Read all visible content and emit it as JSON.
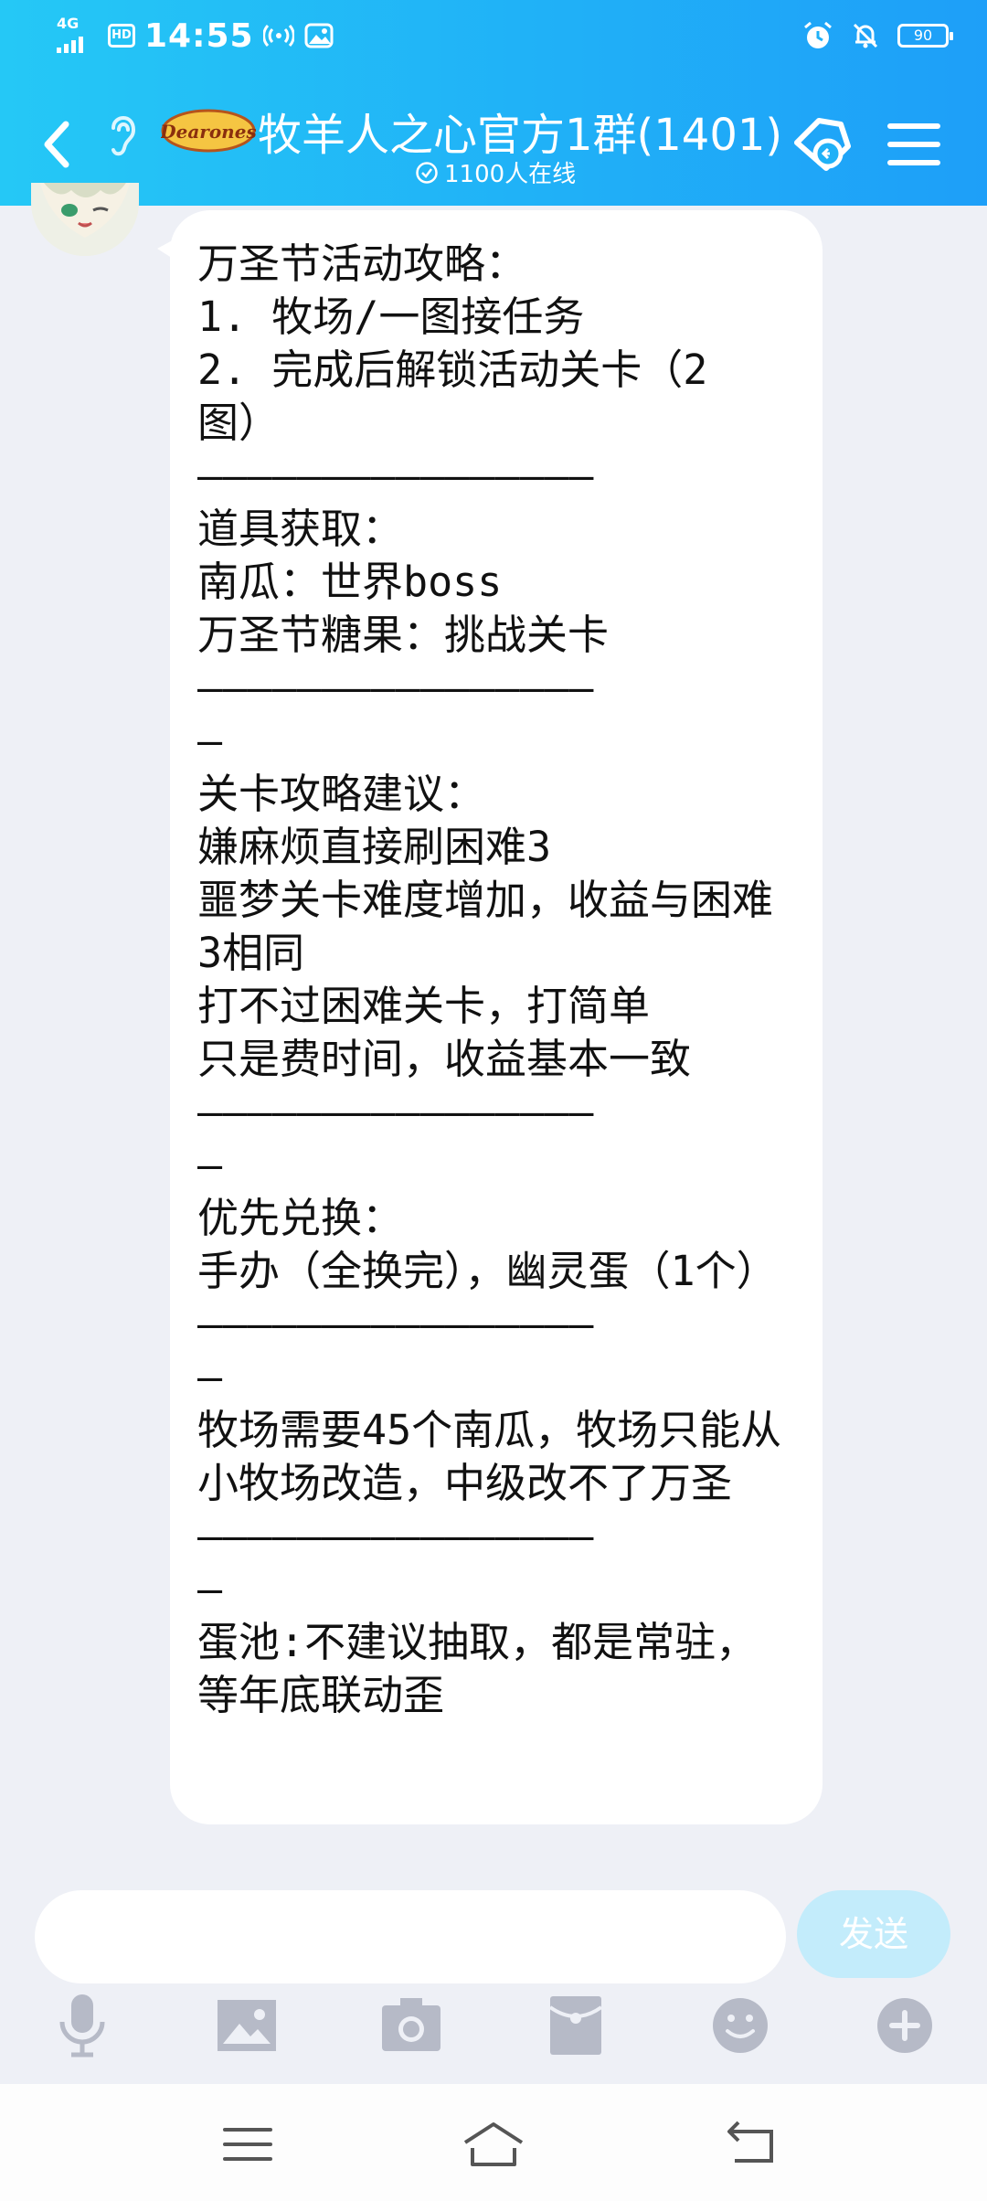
{
  "status_bar": {
    "network": "4G",
    "hd": "HD",
    "time": "14:55",
    "battery": "90"
  },
  "header": {
    "logo_text": "Dearones",
    "title": "牧羊人之心官方1群(1401)",
    "online": "1100人在线"
  },
  "message": {
    "text": "万圣节活动攻略：\n1. 牧场/一图接任务\n2. 完成后解锁活动关卡（2图）\n————————————————\n道具获取：\n南瓜：世界boss\n万圣节糖果：挑战关卡\n————————————————\n—\n关卡攻略建议：\n嫌麻烦直接刷困难3\n噩梦关卡难度增加，收益与困难3相同\n打不过困难关卡，打简单\n只是费时间，收益基本一致\n————————————————\n—\n优先兑换：\n手办（全换完），幽灵蛋（1个）\n————————————————\n—\n牧场需要45个南瓜，牧场只能从小牧场改造，中级改不了万圣\n————————————————\n—\n蛋池:不建议抽取，都是常驻，等年底联动歪"
  },
  "composer": {
    "send_label": "发送"
  },
  "colors": {
    "header_start": "#25c8f6",
    "header_end": "#1e9ff8",
    "send_button": "#c3ecfb",
    "toolbar_icon": "#b6bac7"
  }
}
